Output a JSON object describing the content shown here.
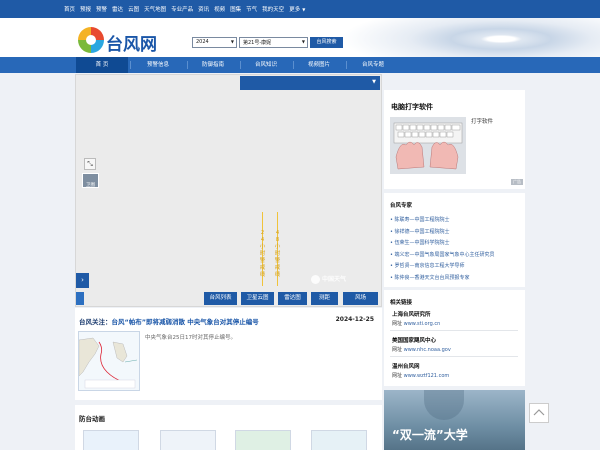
{
  "topnav": [
    "首页",
    "预报",
    "预警",
    "雷达",
    "云图",
    "天气地图",
    "专业产品",
    "资讯",
    "视频",
    "图集",
    "节气",
    "我的天空",
    "更多"
  ],
  "header": {
    "site_name": "台风网",
    "year_value": "2024",
    "typhoon_value": "第21号-康妮",
    "search_label": "台风搜索"
  },
  "mainnav": [
    "首 页",
    "预警信息",
    "防御指南",
    "台风知识",
    "视频图片",
    "台风专题"
  ],
  "map": {
    "zoom_label": "卫图",
    "vertical_labels": [
      "24小时警戒线",
      "48小时警戒线"
    ],
    "watermark": "中国天气",
    "buttons": [
      "台风列表",
      "卫星云图",
      "雷达图",
      "测距",
      "风场"
    ]
  },
  "news": {
    "prefix": "台风关注：",
    "headline": "台风“帕布”即将减弱消散 中央气象台对其停止编号",
    "date": "2024-12-25",
    "desc": "中央气象台25日17时对其停止编号。"
  },
  "anim": {
    "title": "防台动画"
  },
  "ad": {
    "title": "电脑打字软件",
    "subtitle": "打字软件",
    "tag": "广告"
  },
  "experts": {
    "title": "台风专家",
    "items": [
      "陈联寿—中国工程院院士",
      "徐祥德—中国工程院院士",
      "伍荣生—中国科学院院士",
      "端义宏—中国气象局国家气象中心主任研究员",
      "罗哲贤—南京信息工程大学导师",
      "陈仲良—香港天文台台风预报专家"
    ]
  },
  "links": {
    "title": "相关链接",
    "url_prefix": "网址",
    "items": [
      {
        "name": "上海台风研究所",
        "url": "www.sti.org.cn"
      },
      {
        "name": "美国国家飓风中心",
        "url": "www.nhc.noaa.gov"
      },
      {
        "name": "温州台风网",
        "url": "www.wztf121.com"
      }
    ]
  },
  "banner": {
    "text": "“双一流”大学"
  },
  "colors": {
    "primary": "#1f5aa6",
    "nav": "#2868b8",
    "active": "#0f4a93",
    "link": "#2f5e9e",
    "warning_line": "#f0c33a"
  }
}
